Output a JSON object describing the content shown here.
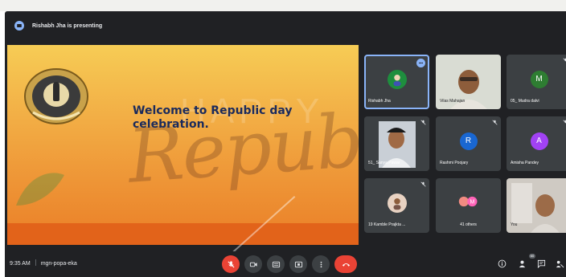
{
  "presenting": {
    "text": "Rishabh Jha is presenting",
    "icon": "present-screen-icon"
  },
  "slide": {
    "headline_line1": "Welcome to Republic day",
    "headline_line2": "celebration.",
    "logo_text": "KNOWLEDGE IS POWER"
  },
  "participants": [
    {
      "name": "Rishabh Jha",
      "type": "avatar-photo",
      "active": true
    },
    {
      "name": "Vilas Mahajan",
      "type": "video"
    },
    {
      "name": "05_ Mudra dalvi",
      "type": "initial",
      "initial": "M",
      "color": "#2e7d32"
    },
    {
      "name": "51_ Sanya Pawar",
      "type": "video"
    },
    {
      "name": "Rashmi Poojary",
      "type": "initial",
      "initial": "R",
      "color": "#1967d2"
    },
    {
      "name": "Amisha Pandey",
      "type": "initial",
      "initial": "A",
      "color": "#a142f4"
    },
    {
      "name": "19 Kamble Prajkta ...",
      "type": "avatar-photo"
    },
    {
      "name": "41 others",
      "type": "others"
    },
    {
      "name": "You",
      "type": "video"
    }
  ],
  "bottom": {
    "time": "9:35 AM",
    "meeting_code": "mgn-popa-eka",
    "participant_count": "60"
  },
  "colors": {
    "meet_bg": "#202124",
    "tile_bg": "#3c4043",
    "accent": "#8ab4f8",
    "danger": "#ea4335"
  }
}
